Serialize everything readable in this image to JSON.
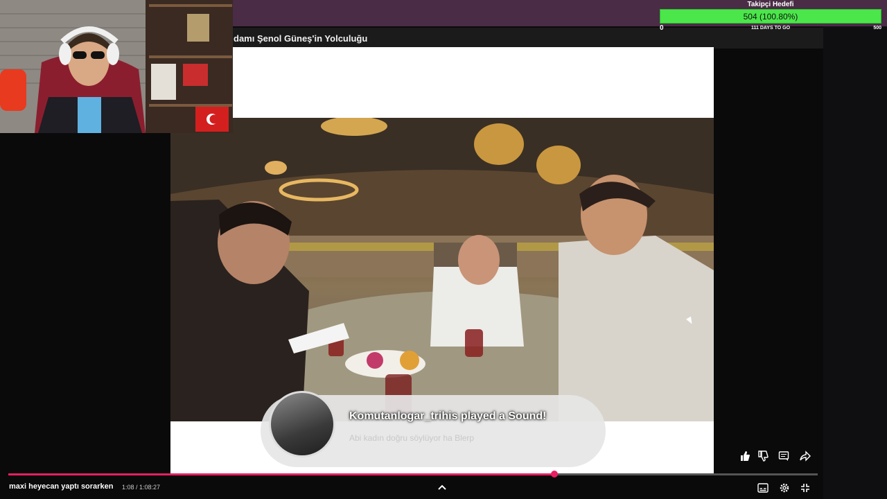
{
  "follower_goal": {
    "title": "Takipçi Hedefi",
    "value": "504 (100.80%)",
    "progress": 1.008,
    "min": "0",
    "days": "111 DAYS TO GO",
    "max": "500",
    "bar_color": "#4ae64a"
  },
  "video": {
    "title": "damı Şenol Güneş'in Yolculuğu",
    "current_time": "1:08 / 1:08:27",
    "played_fraction": 0.675,
    "accent_color": "#e91e63"
  },
  "alert": {
    "title": "Komutanlogar_trihis played a Sound!",
    "message": "Abi kadın doğru söylüyor ha Blerp"
  },
  "chat_overlay": {
    "username": "",
    "text": "maxi heyecan yaptı sorarken"
  },
  "icons": {
    "like": "like-icon",
    "dislike": "dislike-icon",
    "comment": "comment-icon",
    "share": "share-icon",
    "subtitles": "subtitles-icon",
    "settings": "settings-icon",
    "exit_fullscreen": "exit-fullscreen-icon",
    "expand": "chevron-up-icon"
  }
}
